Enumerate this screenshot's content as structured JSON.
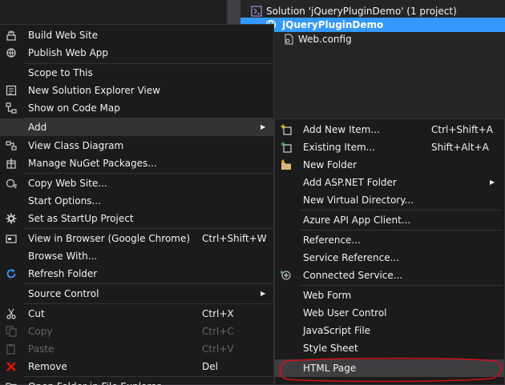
{
  "solution_explorer": {
    "solution_label": "Solution 'jQueryPluginDemo' (1 project)",
    "project_label": "jQueryPluginDemo",
    "webconfig_label": "Web.config"
  },
  "context_menu": {
    "items": [
      {
        "label": "Build Web Site",
        "shortcut": "",
        "icon": "build-icon"
      },
      {
        "label": "Publish Web App",
        "shortcut": "",
        "icon": "publish-icon"
      },
      {
        "label": "Scope to This",
        "shortcut": "",
        "icon": ""
      },
      {
        "label": "New Solution Explorer View",
        "shortcut": "",
        "icon": "new-view-icon"
      },
      {
        "label": "Show on Code Map",
        "shortcut": "",
        "icon": "code-map-icon"
      },
      {
        "label": "Add",
        "shortcut": "",
        "icon": ""
      },
      {
        "label": "View Class Diagram",
        "shortcut": "",
        "icon": "class-diagram-icon"
      },
      {
        "label": "Manage NuGet Packages...",
        "shortcut": "",
        "icon": "nuget-icon"
      },
      {
        "label": "Copy Web Site...",
        "shortcut": "",
        "icon": "copy-site-icon"
      },
      {
        "label": "Start Options...",
        "shortcut": "",
        "icon": ""
      },
      {
        "label": "Set as StartUp Project",
        "shortcut": "",
        "icon": "gear-icon"
      },
      {
        "label": "View in Browser (Google Chrome)",
        "shortcut": "Ctrl+Shift+W",
        "icon": "browser-icon"
      },
      {
        "label": "Browse With...",
        "shortcut": "",
        "icon": ""
      },
      {
        "label": "Refresh Folder",
        "shortcut": "",
        "icon": "refresh-icon"
      },
      {
        "label": "Source Control",
        "shortcut": "",
        "icon": ""
      },
      {
        "label": "Cut",
        "shortcut": "Ctrl+X",
        "icon": "cut-icon"
      },
      {
        "label": "Copy",
        "shortcut": "Ctrl+C",
        "icon": "copy-icon"
      },
      {
        "label": "Paste",
        "shortcut": "Ctrl+V",
        "icon": "paste-icon"
      },
      {
        "label": "Remove",
        "shortcut": "Del",
        "icon": "remove-icon"
      },
      {
        "label": "Open Folder in File Explorer",
        "shortcut": "",
        "icon": "folder-open-icon"
      }
    ]
  },
  "add_submenu": {
    "items": [
      {
        "label": "Add New Item...",
        "shortcut": "Ctrl+Shift+A",
        "icon": "new-item-icon"
      },
      {
        "label": "Existing Item...",
        "shortcut": "Shift+Alt+A",
        "icon": "existing-item-icon"
      },
      {
        "label": "New Folder",
        "shortcut": "",
        "icon": "new-folder-icon"
      },
      {
        "label": "Add ASP.NET Folder",
        "shortcut": "",
        "icon": ""
      },
      {
        "label": "New Virtual Directory...",
        "shortcut": "",
        "icon": ""
      },
      {
        "label": "Azure API App Client...",
        "shortcut": "",
        "icon": ""
      },
      {
        "label": "Reference...",
        "shortcut": "",
        "icon": ""
      },
      {
        "label": "Service Reference...",
        "shortcut": "",
        "icon": ""
      },
      {
        "label": "Connected Service...",
        "shortcut": "",
        "icon": "connected-service-icon"
      },
      {
        "label": "Web Form",
        "shortcut": "",
        "icon": ""
      },
      {
        "label": "Web User Control",
        "shortcut": "",
        "icon": ""
      },
      {
        "label": "JavaScript File",
        "shortcut": "",
        "icon": ""
      },
      {
        "label": "Style Sheet",
        "shortcut": "",
        "icon": ""
      },
      {
        "label": "HTML Page",
        "shortcut": "",
        "icon": ""
      }
    ]
  },
  "colors": {
    "menu_bg": "#1b1b1c",
    "highlight": "#333334",
    "selection": "#3399ff",
    "annotation": "#e51400"
  }
}
